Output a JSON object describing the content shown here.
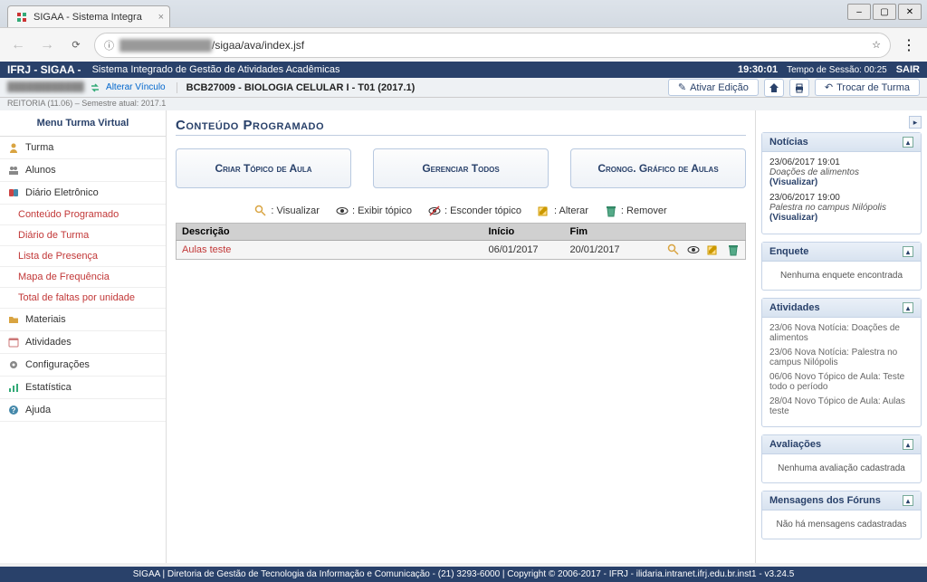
{
  "browser": {
    "tab_title": "SIGAA - Sistema Integra",
    "url_visible": "/sigaa/ava/index.jsf"
  },
  "header": {
    "logo": "IFRJ - SIGAA -",
    "system_name": "Sistema Integrado de Gestão de Atividades Acadêmicas",
    "time": "19:30:01",
    "session_label": "Tempo de Sessão: 00:25",
    "logout": "SAIR"
  },
  "subheader": {
    "alterar": "Alterar Vínculo",
    "reitoria": "REITORIA (11.06) – Semestre atual: 2017.1",
    "course": "BCB27009 - BIOLOGIA CELULAR I - T01 (2017.1)",
    "ativar": "Ativar Edição",
    "trocar": "Trocar de Turma"
  },
  "nav": {
    "title": "Menu Turma Virtual",
    "items": [
      {
        "label": "Turma"
      },
      {
        "label": "Alunos"
      },
      {
        "label": "Diário Eletrônico"
      }
    ],
    "diario_subs": [
      "Conteúdo Programado",
      "Diário de Turma",
      "Lista de Presença",
      "Mapa de Frequência",
      "Total de faltas por unidade"
    ],
    "rest": [
      "Materiais",
      "Atividades",
      "Configurações",
      "Estatística",
      "Ajuda"
    ]
  },
  "content": {
    "title": "Conteúdo Programado",
    "buttons": {
      "criar": "Criar Tópico de Aula",
      "gerenciar": "Gerenciar Todos",
      "cronog": "Cronog. Gráfico de Aulas"
    },
    "legend": {
      "visualizar": ": Visualizar",
      "exibir": ": Exibir tópico",
      "esconder": ": Esconder tópico",
      "alterar": ": Alterar",
      "remover": ": Remover"
    },
    "table": {
      "col_desc": "Descrição",
      "col_inicio": "Início",
      "col_fim": "Fim",
      "rows": [
        {
          "desc": "Aulas teste",
          "inicio": "06/01/2017",
          "fim": "20/01/2017"
        }
      ]
    }
  },
  "right": {
    "noticias": {
      "title": "Notícias",
      "items": [
        {
          "date": "23/06/2017 19:01",
          "title": "Doações de alimentos",
          "link": "(Visualizar)"
        },
        {
          "date": "23/06/2017 19:00",
          "title": "Palestra no campus Nilópolis",
          "link": "(Visualizar)"
        }
      ]
    },
    "enquete": {
      "title": "Enquete",
      "empty": "Nenhuma enquete encontrada"
    },
    "atividades": {
      "title": "Atividades",
      "items": [
        "23/06 Nova Notícia: Doações de alimentos",
        "23/06 Nova Notícia: Palestra no campus Nilópolis",
        "06/06 Novo Tópico de Aula: Teste todo o período",
        "28/04 Novo Tópico de Aula: Aulas teste"
      ]
    },
    "avaliacoes": {
      "title": "Avaliações",
      "empty": "Nenhuma avaliação cadastrada"
    },
    "forums": {
      "title": "Mensagens dos Fóruns",
      "empty": "Não há mensagens cadastradas"
    }
  },
  "footer": "SIGAA | Diretoria de Gestão de Tecnologia da Informação e Comunicação - (21) 3293-6000 | Copyright © 2006-2017 - IFRJ - ilidaria.intranet.ifrj.edu.br.inst1 - v3.24.5"
}
